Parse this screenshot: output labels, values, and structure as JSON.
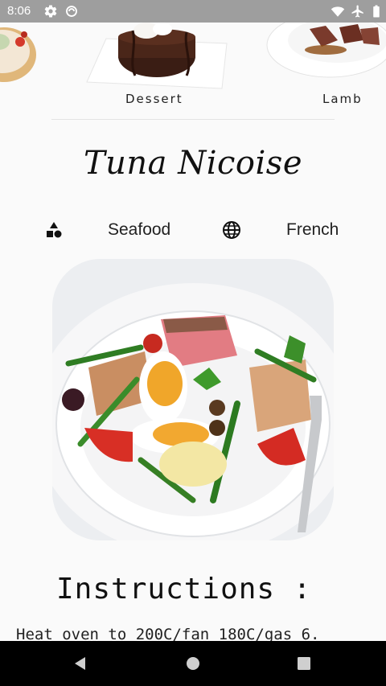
{
  "status_bar": {
    "time": "8:06"
  },
  "categories": [
    {
      "label": "Dessert"
    },
    {
      "label": "Lamb"
    }
  ],
  "meal": {
    "title": "Tuna Nicoise",
    "category": "Seafood",
    "area": "French"
  },
  "instructions": {
    "heading": "Instructions :",
    "text": "Heat oven to 200C/fan 180C/gas 6."
  },
  "colors": {
    "status_bar": "#9e9e9e",
    "nav_bar": "#000000",
    "background": "#fafafa"
  },
  "icons": {
    "category_icon": "shapes-icon",
    "area_icon": "globe-icon",
    "nav_back": "back-icon",
    "nav_home": "home-icon",
    "nav_recents": "recents-icon"
  }
}
